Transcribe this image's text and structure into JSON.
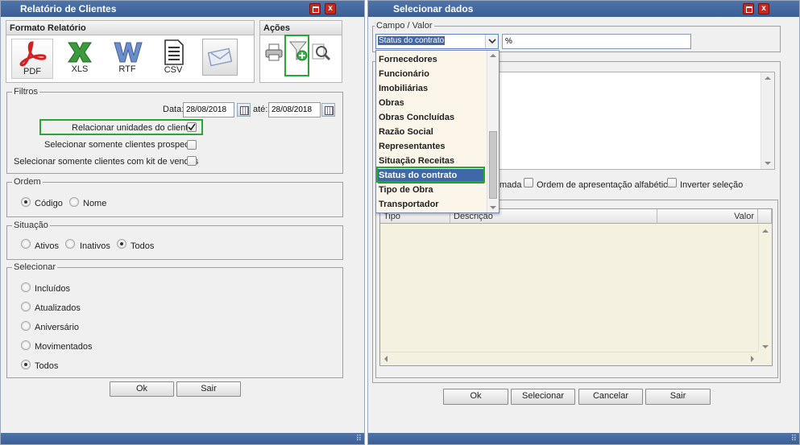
{
  "left_window": {
    "title": "Relatório de Clientes",
    "formato": {
      "header": "Formato Relatório",
      "items": [
        {
          "label": "PDF",
          "icon": "pdf-icon"
        },
        {
          "label": "XLS",
          "icon": "excel-icon"
        },
        {
          "label": "RTF",
          "icon": "word-icon"
        },
        {
          "label": "CSV",
          "icon": "document-icon"
        },
        {
          "label": "",
          "icon": "email-icon"
        }
      ]
    },
    "acoes": {
      "header": "Ações",
      "icons": [
        "printer-icon",
        "filter-add-icon",
        "search-icon"
      ]
    },
    "filtros": {
      "legend": "Filtros",
      "data_label": "Data:",
      "data_from": "28/08/2018",
      "ate_label": "até:",
      "data_to": "28/08/2018",
      "relacionar_label": "Relacionar unidades do cliente",
      "relacionar_checked": true,
      "prospects_label": "Selecionar somente clientes prospects",
      "prospects_checked": false,
      "kit_label": "Selecionar somente clientes com kit de vendas",
      "kit_checked": false
    },
    "ordem": {
      "legend": "Ordem",
      "options": [
        {
          "label": "Código",
          "selected": true
        },
        {
          "label": "Nome",
          "selected": false
        }
      ]
    },
    "situacao": {
      "legend": "Situação",
      "options": [
        {
          "label": "Ativos",
          "selected": false
        },
        {
          "label": "Inativos",
          "selected": false
        },
        {
          "label": "Todos",
          "selected": true
        }
      ]
    },
    "selecionar": {
      "legend": "Selecionar",
      "options": [
        {
          "label": "Incluídos",
          "selected": false
        },
        {
          "label": "Atualizados",
          "selected": false
        },
        {
          "label": "Aniversário",
          "selected": false
        },
        {
          "label": "Movimentados",
          "selected": false
        },
        {
          "label": "Todos",
          "selected": true
        }
      ]
    },
    "ok_label": "Ok",
    "sair_label": "Sair"
  },
  "right_window": {
    "title": "Selecionar dados",
    "campo_legend": "Campo / Valor",
    "campo_selected": "Status do contrato",
    "valor_value": "%",
    "dropdown_items": [
      {
        "label": "Fornecedores",
        "selected": false
      },
      {
        "label": "Funcionário",
        "selected": false
      },
      {
        "label": "Imobiliárias",
        "selected": false
      },
      {
        "label": "Obras",
        "selected": false
      },
      {
        "label": "Obras Concluídas",
        "selected": false
      },
      {
        "label": "Razão Social",
        "selected": false
      },
      {
        "label": "Representantes",
        "selected": false
      },
      {
        "label": "Situação Receitas",
        "selected": false
      },
      {
        "label": "Status do contrato",
        "selected": true
      },
      {
        "label": "Tipo de Obra",
        "selected": false
      },
      {
        "label": "Transportador",
        "selected": false
      }
    ],
    "option_partial": "mada",
    "option_alfabetica": "Ordem de apresentação alfabética",
    "option_inverter": "Inverter seleção",
    "grid_headers": [
      "Tipo",
      "Descrição",
      "Valor"
    ],
    "ok_label": "Ok",
    "selecionar_label": "Selecionar",
    "cancelar_label": "Cancelar",
    "sair_label": "Sair"
  },
  "colors": {
    "titlebar": "#3a5f96",
    "highlight": "#22aa33",
    "dropdown_bg": "#fcf5e9",
    "dropdown_selected": "#3e68a8",
    "grid_bg": "#f5f1e0"
  }
}
